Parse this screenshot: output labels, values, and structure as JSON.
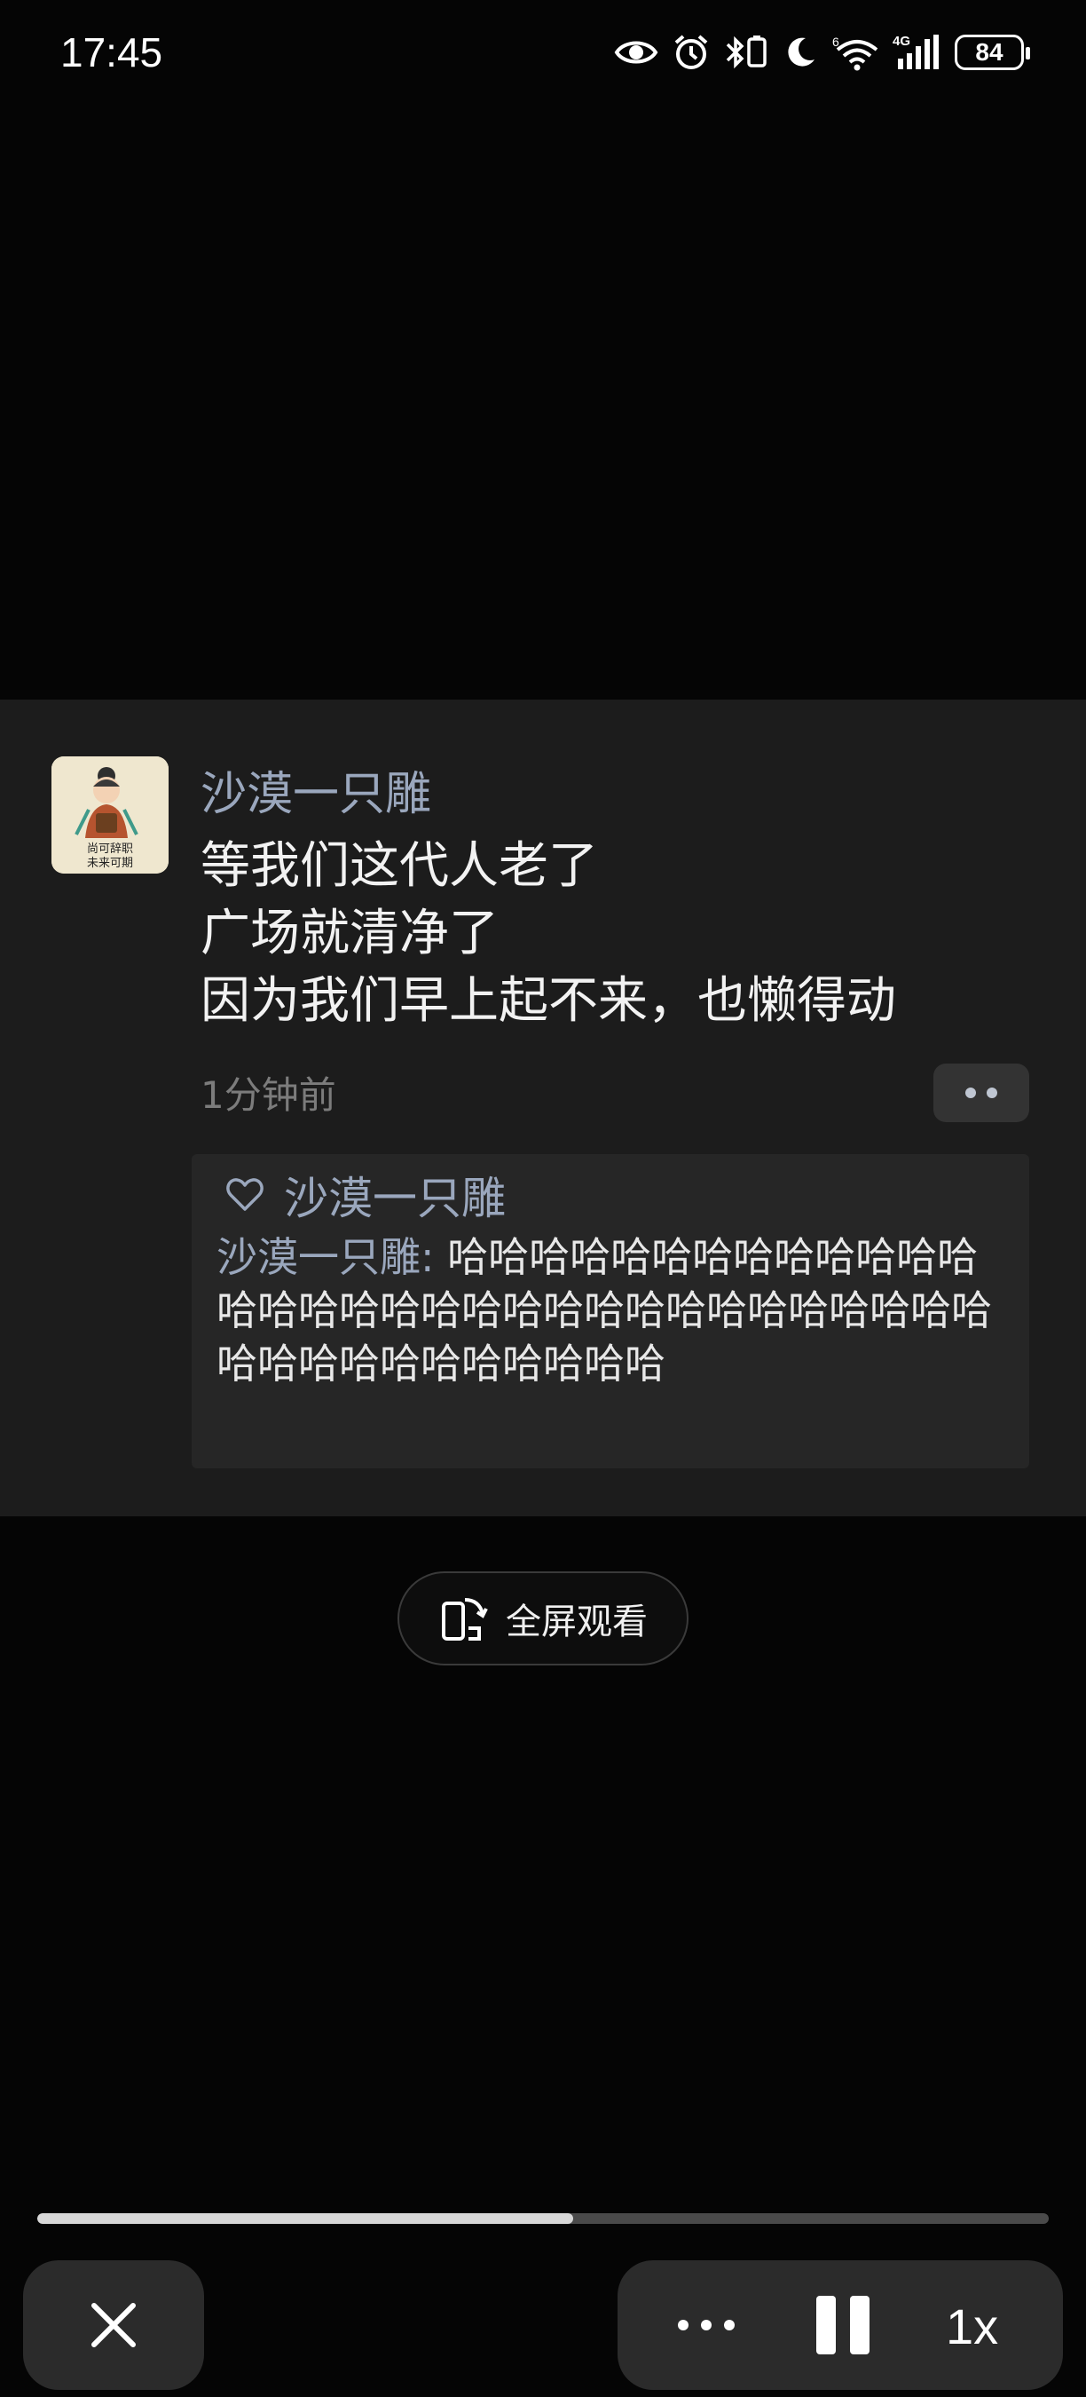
{
  "status_bar": {
    "time": "17:45",
    "battery": "84",
    "network_label": "4G",
    "icons": [
      "eye-icon",
      "alarm-icon",
      "bluetooth-icon",
      "moon-icon",
      "wifi-icon",
      "signal-icon",
      "battery-icon"
    ]
  },
  "comment": {
    "author": "沙漠一只雕",
    "lines": [
      "等我们这代人老了",
      "广场就清净了",
      "因为我们早上起不来，也懒得动"
    ],
    "time_ago": "1分钟前",
    "avatar_caption": [
      "尚可辞职",
      "未来可期"
    ],
    "reply": {
      "liked_by": "沙漠一只雕",
      "author": "沙漠一只雕",
      "separator": ": ",
      "text": "哈哈哈哈哈哈哈哈哈哈哈哈哈哈哈哈哈哈哈哈哈哈哈哈哈哈哈哈哈哈哈哈哈哈哈哈哈哈哈哈哈哈哈"
    }
  },
  "fullscreen_label": "全屏观看",
  "playback": {
    "progress_percent": 53,
    "speed": "1x"
  },
  "colors": {
    "background": "#050505",
    "card": "#1c1c1c",
    "name_accent": "#9aa7bd"
  }
}
